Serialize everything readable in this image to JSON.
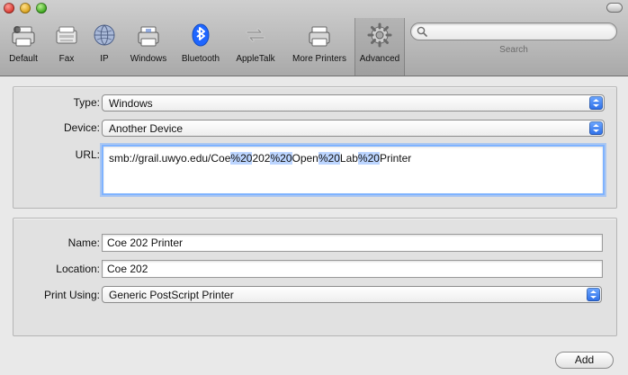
{
  "toolbar": {
    "items": [
      {
        "label": "Default",
        "icon": "default-printer-icon"
      },
      {
        "label": "Fax",
        "icon": "fax-icon"
      },
      {
        "label": "IP",
        "icon": "ip-globe-icon"
      },
      {
        "label": "Windows",
        "icon": "windows-printer-icon"
      },
      {
        "label": "Bluetooth",
        "icon": "bluetooth-icon"
      },
      {
        "label": "AppleTalk",
        "icon": "appletalk-icon"
      },
      {
        "label": "More Printers",
        "icon": "more-printers-icon"
      },
      {
        "label": "Advanced",
        "icon": "gear-icon",
        "selected": true
      }
    ],
    "search": {
      "placeholder": "",
      "label": "Search"
    }
  },
  "connection": {
    "type_label": "Type:",
    "type_value": "Windows",
    "device_label": "Device:",
    "device_value": "Another Device",
    "url_label": "URL:",
    "url_parts": [
      {
        "text": "smb://grail.uwyo.edu/Coe",
        "hl": false
      },
      {
        "text": "%20",
        "hl": true
      },
      {
        "text": "202",
        "hl": false
      },
      {
        "text": "%20",
        "hl": true
      },
      {
        "text": "Open",
        "hl": false
      },
      {
        "text": "%20",
        "hl": true
      },
      {
        "text": "Lab",
        "hl": false
      },
      {
        "text": "%20",
        "hl": true
      },
      {
        "text": "Printer",
        "hl": false
      }
    ]
  },
  "details": {
    "name_label": "Name:",
    "name_value": "Coe 202 Printer",
    "location_label": "Location:",
    "location_value": "Coe 202",
    "print_using_label": "Print Using:",
    "print_using_value": "Generic PostScript Printer"
  },
  "actions": {
    "add_label": "Add"
  },
  "colors": {
    "accent": "#2d6fe8",
    "url_highlight": "#bcd5ff"
  }
}
